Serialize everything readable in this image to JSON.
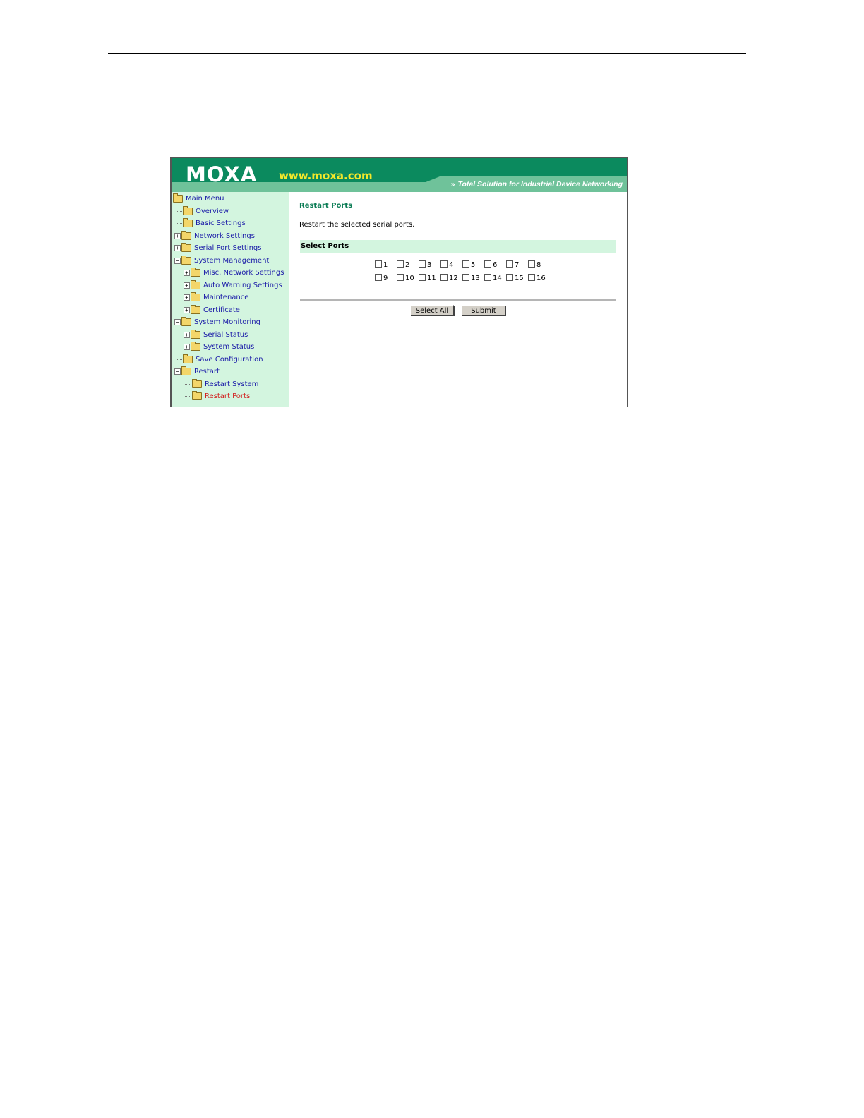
{
  "header": {
    "logo": "MOXA",
    "website": "www.moxa.com",
    "tagline": "Total Solution for Industrial Device Networking",
    "colors": {
      "banner": "#0b8a5e",
      "website_text": "#f4e82a"
    }
  },
  "sidebar": {
    "items": [
      {
        "label": "Main Menu",
        "expander": "",
        "level": 0
      },
      {
        "label": "Overview",
        "expander": "",
        "level": 1
      },
      {
        "label": "Basic Settings",
        "expander": "",
        "level": 1
      },
      {
        "label": "Network Settings",
        "expander": "+",
        "level": 1
      },
      {
        "label": "Serial Port Settings",
        "expander": "+",
        "level": 1
      },
      {
        "label": "System Management",
        "expander": "−",
        "level": 1
      },
      {
        "label": "Misc. Network Settings",
        "expander": "+",
        "level": 2
      },
      {
        "label": "Auto Warning Settings",
        "expander": "+",
        "level": 2
      },
      {
        "label": "Maintenance",
        "expander": "+",
        "level": 2
      },
      {
        "label": "Certificate",
        "expander": "+",
        "level": 2
      },
      {
        "label": "System Monitoring",
        "expander": "−",
        "level": 1
      },
      {
        "label": "Serial Status",
        "expander": "+",
        "level": 2
      },
      {
        "label": "System Status",
        "expander": "+",
        "level": 2
      },
      {
        "label": "Save Configuration",
        "expander": "",
        "level": 1
      },
      {
        "label": "Restart",
        "expander": "−",
        "level": 1
      },
      {
        "label": "Restart System",
        "expander": "",
        "level": 2
      },
      {
        "label": "Restart Ports",
        "expander": "",
        "level": 2
      }
    ],
    "active_item": "Restart Ports"
  },
  "main": {
    "title": "Restart Ports",
    "description": "Restart the selected serial ports.",
    "section_title": "Select Ports",
    "ports": [
      "1",
      "2",
      "3",
      "4",
      "5",
      "6",
      "7",
      "8",
      "9",
      "10",
      "11",
      "12",
      "13",
      "14",
      "15",
      "16"
    ],
    "buttons": {
      "select_all": "Select All",
      "submit": "Submit"
    }
  }
}
